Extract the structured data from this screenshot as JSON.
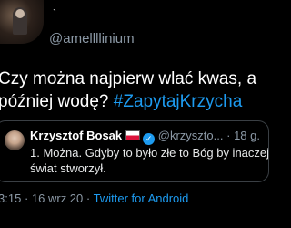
{
  "tweet": {
    "tick_mark": "`",
    "handle": "@amellllinium",
    "text_line1_plain": "Czy można najpierw wlać kwas, a",
    "text_line2_plain": "później wodę? ",
    "hashtag": "#ZapytajKrzycha"
  },
  "quoted": {
    "name": "Krzysztof Bosak",
    "verified_icon": "✓",
    "handle": "@krzyszto...",
    "date": "18 g.",
    "text": "1. Można. Gdyby to było złe to Bóg by inaczej świat stworzył."
  },
  "meta": {
    "time": "3:15",
    "date": "16 wrz 20",
    "separator": "·",
    "source": "Twitter for Android"
  },
  "colors": {
    "background": "#000000",
    "link": "#1d9bf0",
    "muted": "#8b98a5"
  }
}
